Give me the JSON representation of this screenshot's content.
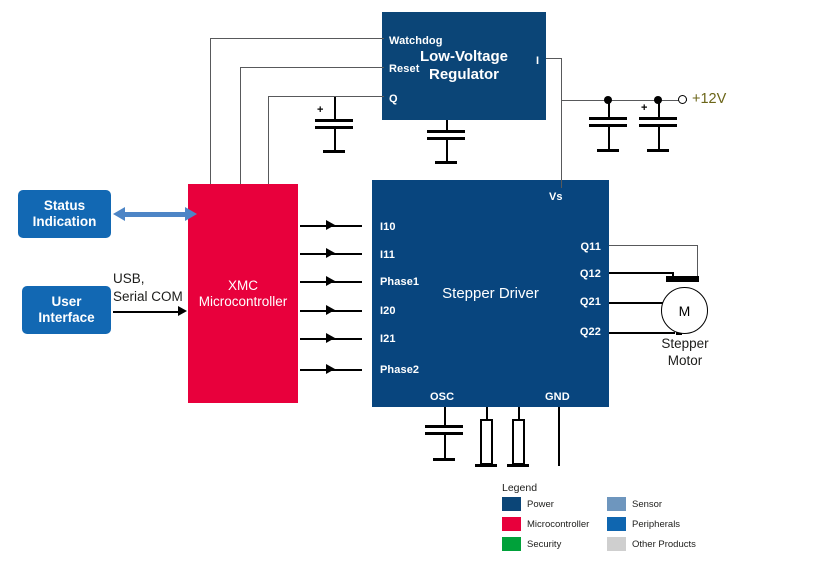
{
  "diagram": {
    "title": "Stepper motor control block diagram",
    "blocks": {
      "regulator": {
        "label": "Low-Voltage\nRegulator",
        "line1": "Low-Voltage",
        "line2": "Regulator",
        "pins": {
          "watchdog": "Watchdog",
          "reset": "Reset",
          "q": "Q",
          "i": "I"
        }
      },
      "driver": {
        "label": "Stepper Driver",
        "inputs": [
          "I10",
          "I11",
          "Phase1",
          "I20",
          "I21",
          "Phase2"
        ],
        "outputs": [
          "Q11",
          "Q12",
          "Q21",
          "Q22"
        ],
        "supply_pin": "Vs",
        "osc_pin": "OSC",
        "gnd_pin": "GND"
      },
      "mcu": {
        "line1": "XMC",
        "line2": "Microcontroller"
      },
      "status": {
        "line1": "Status",
        "line2": "Indication"
      },
      "user": {
        "line1": "User",
        "line2": "Interface"
      }
    },
    "labels": {
      "usb_serial_line1": "USB,",
      "usb_serial_line2": "Serial COM",
      "supply_rail": "+12V",
      "motor_symbol": "M",
      "motor_line1": "Stepper",
      "motor_line2": "Motor",
      "cap_polarity": "+"
    },
    "legend": {
      "title": "Legend",
      "items": [
        {
          "label": "Power",
          "color": "#0B4577"
        },
        {
          "label": "Microcontroller",
          "color": "#E8003C"
        },
        {
          "label": "Security",
          "color": "#00A13A"
        },
        {
          "label": "Sensor",
          "color": "#6E96BE"
        },
        {
          "label": "Peripherals",
          "color": "#0F66B0"
        },
        {
          "label": "Other Products",
          "color": "#CFCFCF"
        }
      ]
    },
    "colors": {
      "power_blue": "#0B4577",
      "driver_blue": "#08457E",
      "mcu_red": "#E8003C",
      "peripheral_blue": "#1268B3",
      "wire_gray": "#58595B",
      "wire_black": "#000000",
      "rail_label": "#6B6518",
      "biarrow_blue": "#4D85C6"
    }
  }
}
